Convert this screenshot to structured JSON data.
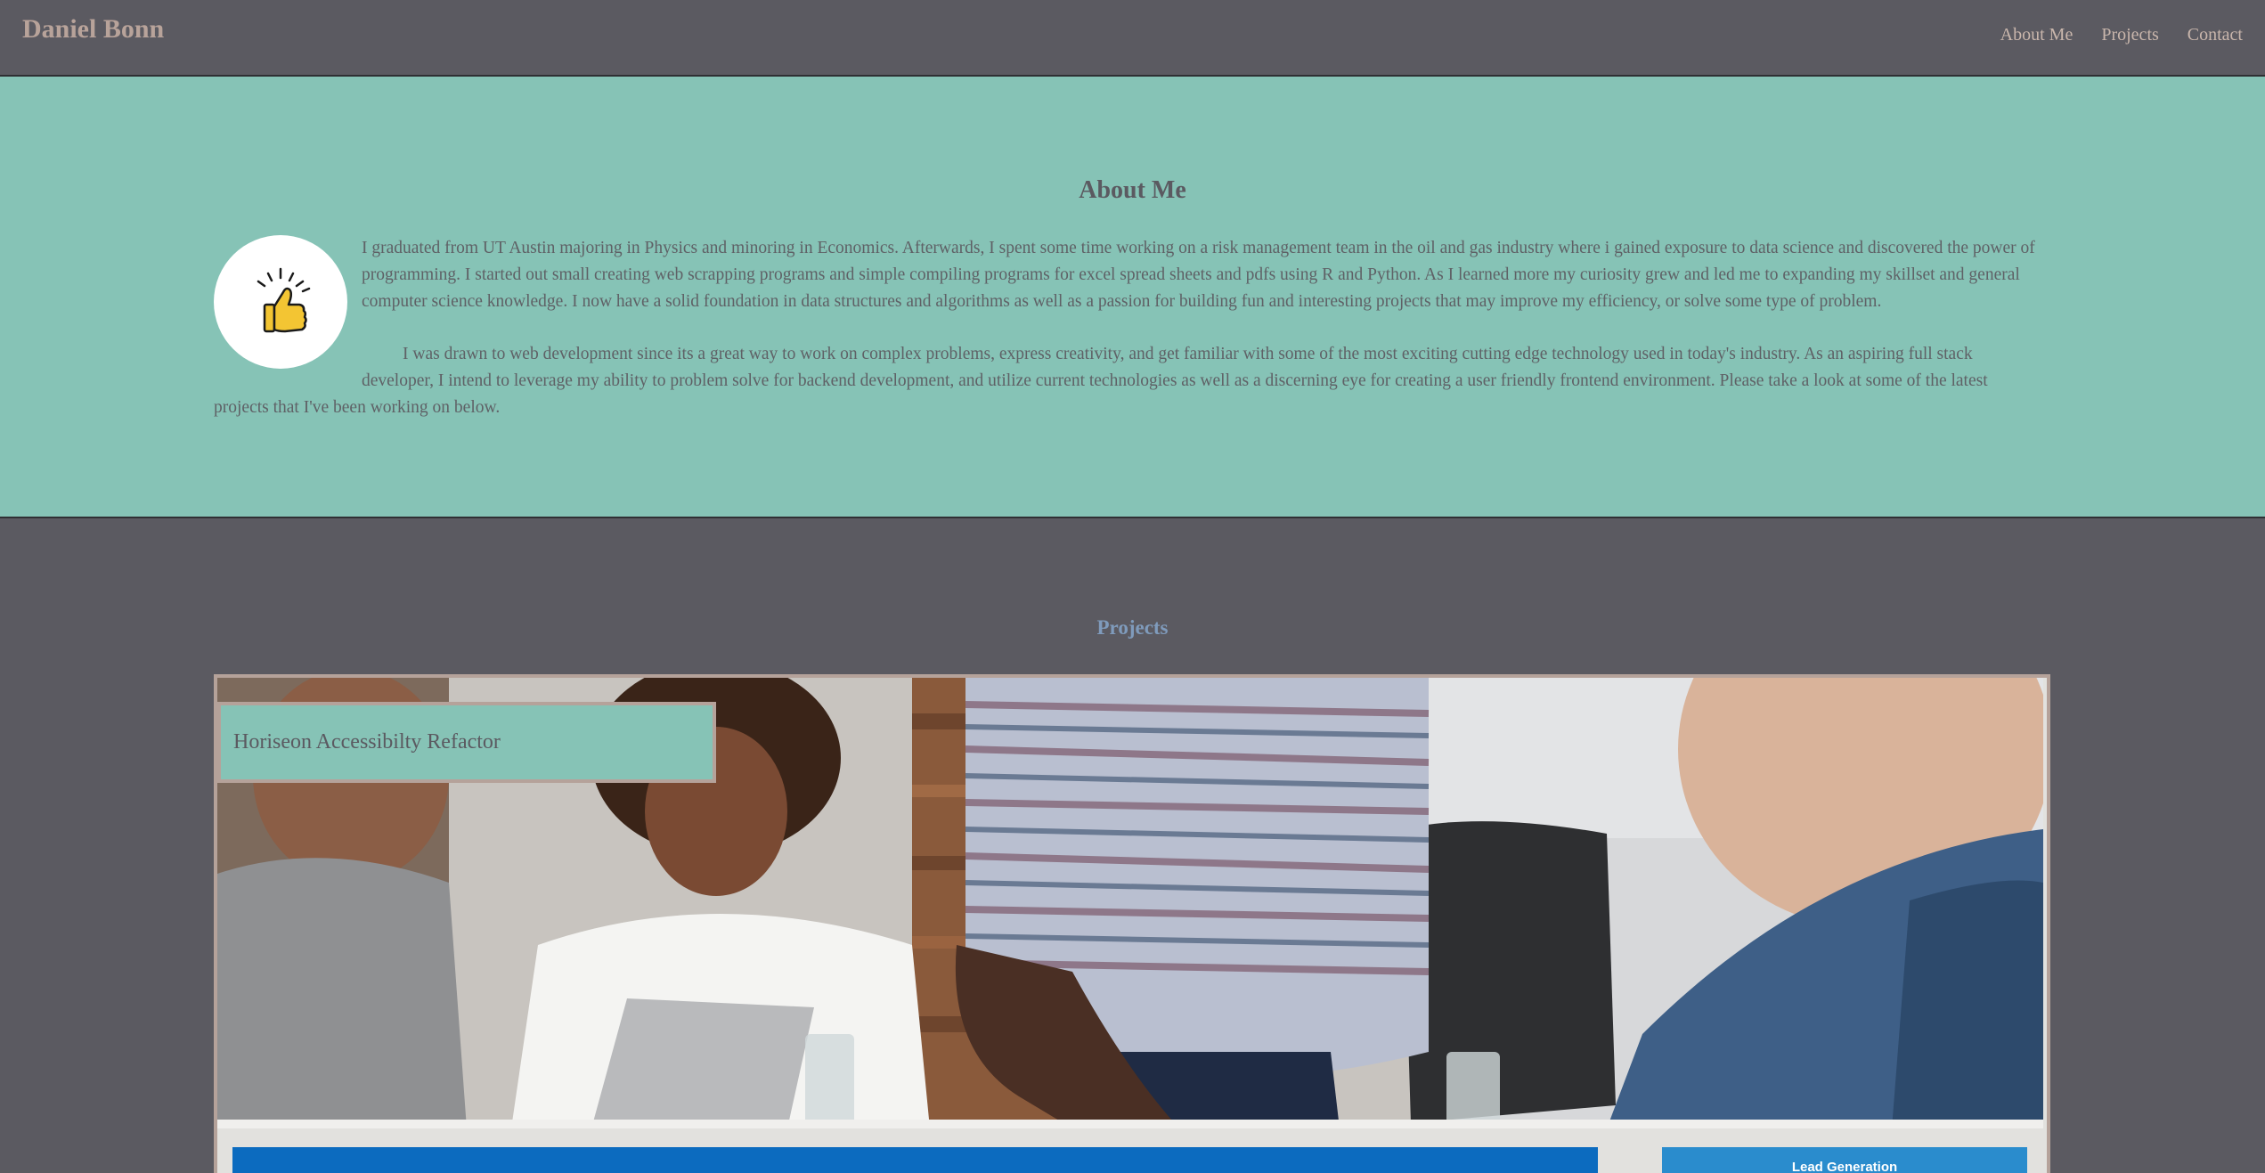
{
  "header": {
    "brand": "Daniel Bonn",
    "nav": [
      "About Me",
      "Projects",
      "Contact"
    ]
  },
  "about": {
    "title": "About Me",
    "avatar_icon": "thumbs-up-icon",
    "paragraphs": [
      "I graduated from UT Austin majoring in Physics and minoring in Economics. Afterwards, I spent some time working on a risk management team in the oil and gas industry where i gained exposure to data science and discovered the power of programming. I started out small creating web scrapping programs and simple compiling programs for excel spread sheets and pdfs using R and Python. As I learned more my curiosity grew and led me to expanding my skillset and general computer science knowledge. I now have a solid foundation in data structures and algorithms as well as a passion for building fun and interesting projects that may improve my efficiency, or solve some type of problem.",
      "I was drawn to web development since its a great way to work on complex problems, express creativity, and get familiar with some of the most exciting cutting edge technology used in today's industry. As an aspiring full stack developer, I intend to leverage my ability to problem solve for backend development, and utilize current technologies as well as a discerning eye for creating a user friendly frontend environment. Please take a look at some of the latest projects that I've been working on below."
    ]
  },
  "projects": {
    "title": "Projects",
    "items": [
      {
        "name": "Horiseon Accessibilty Refactor",
        "preview_button": "Lead Generation"
      }
    ]
  },
  "colors": {
    "page_bg": "#5b5a61",
    "about_bg": "#86c3b6",
    "brand": "#b8a39a",
    "projects_title": "#7f9bbc",
    "card_border": "#b5a29a"
  }
}
